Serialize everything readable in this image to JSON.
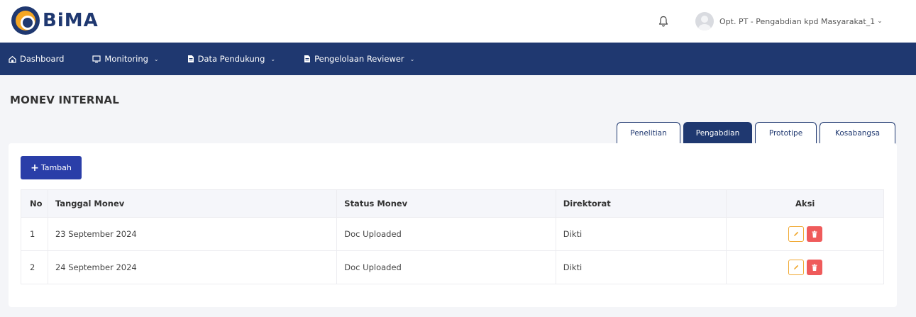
{
  "app": {
    "logo_text": "BiMA"
  },
  "header": {
    "user_name": "Opt. PT - Pengabdian kpd Masyarakat_1",
    "user_caret": "⌄"
  },
  "nav": {
    "items": [
      {
        "label": "Dashboard",
        "icon": "home-icon",
        "has_dropdown": false
      },
      {
        "label": "Monitoring",
        "icon": "monitor-icon",
        "has_dropdown": true
      },
      {
        "label": "Data Pendukung",
        "icon": "document-icon",
        "has_dropdown": true
      },
      {
        "label": "Pengelolaan Reviewer",
        "icon": "document-icon",
        "has_dropdown": true
      }
    ]
  },
  "page": {
    "title": "MONEV INTERNAL"
  },
  "tabs": [
    {
      "label": "Penelitian",
      "active": false
    },
    {
      "label": "Pengabdian",
      "active": true
    },
    {
      "label": "Prototipe",
      "active": false
    },
    {
      "label": "Kosabangsa",
      "active": false
    }
  ],
  "toolbar": {
    "add_label": "Tambah"
  },
  "table": {
    "headers": {
      "no": "No",
      "date": "Tanggal Monev",
      "status": "Status Monev",
      "directorate": "Direktorat",
      "actions": "Aksi"
    },
    "rows": [
      {
        "no": "1",
        "date": "23 September 2024",
        "status": "Doc Uploaded",
        "directorate": "Dikti"
      },
      {
        "no": "2",
        "date": "24 September 2024",
        "status": "Doc Uploaded",
        "directorate": "Dikti"
      }
    ]
  },
  "colors": {
    "primary": "#1f3870",
    "button": "#2a3ea8",
    "edit": "#f0a830",
    "delete": "#ef5b5b"
  }
}
